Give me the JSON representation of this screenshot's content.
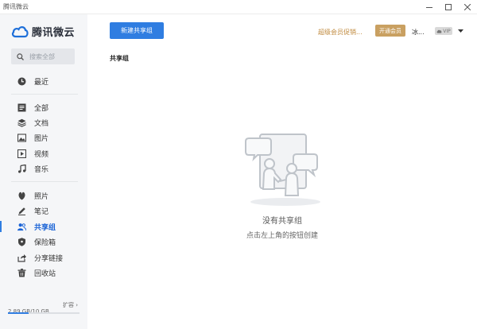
{
  "window": {
    "title": "腾讯微云"
  },
  "logo": {
    "text": "腾讯微云"
  },
  "search": {
    "placeholder": "搜索全部"
  },
  "sidebar": {
    "recent": "最近",
    "groups": [
      {
        "id": "all",
        "label": "全部"
      },
      {
        "id": "docs",
        "label": "文档"
      },
      {
        "id": "images",
        "label": "图片"
      },
      {
        "id": "videos",
        "label": "视频"
      },
      {
        "id": "music",
        "label": "音乐"
      }
    ],
    "tools": [
      {
        "id": "photos",
        "label": "照片"
      },
      {
        "id": "notes",
        "label": "笔记"
      },
      {
        "id": "shared",
        "label": "共享组"
      },
      {
        "id": "vault",
        "label": "保险箱"
      },
      {
        "id": "links",
        "label": "分享链接"
      },
      {
        "id": "recycle",
        "label": "回收站"
      }
    ],
    "active": "shared"
  },
  "storage": {
    "used": "2.89 GB/10 GB",
    "expand": "扩容",
    "fraction": 0.289
  },
  "toolbar": {
    "new_group": "新建共享组",
    "promo": "超级会员促销...",
    "open_vip": "开通会员",
    "user": "冰...",
    "vip": "VIP"
  },
  "main": {
    "section_title": "共享组",
    "empty_title": "没有共享组",
    "empty_hint": "点击左上角的按钮创建"
  },
  "colors": {
    "accent": "#2f7de1",
    "gold": "#c9a061"
  },
  "icons": [
    "minimize-icon",
    "maximize-icon",
    "close-icon",
    "cloud-logo-icon",
    "search-icon",
    "clock-icon",
    "list-icon",
    "layers-icon",
    "image-icon",
    "video-icon",
    "music-icon",
    "photo-petal-icon",
    "pen-icon",
    "users-icon",
    "shield-icon",
    "share-icon",
    "trash-icon",
    "cloud-icon",
    "chevron-down-icon"
  ]
}
